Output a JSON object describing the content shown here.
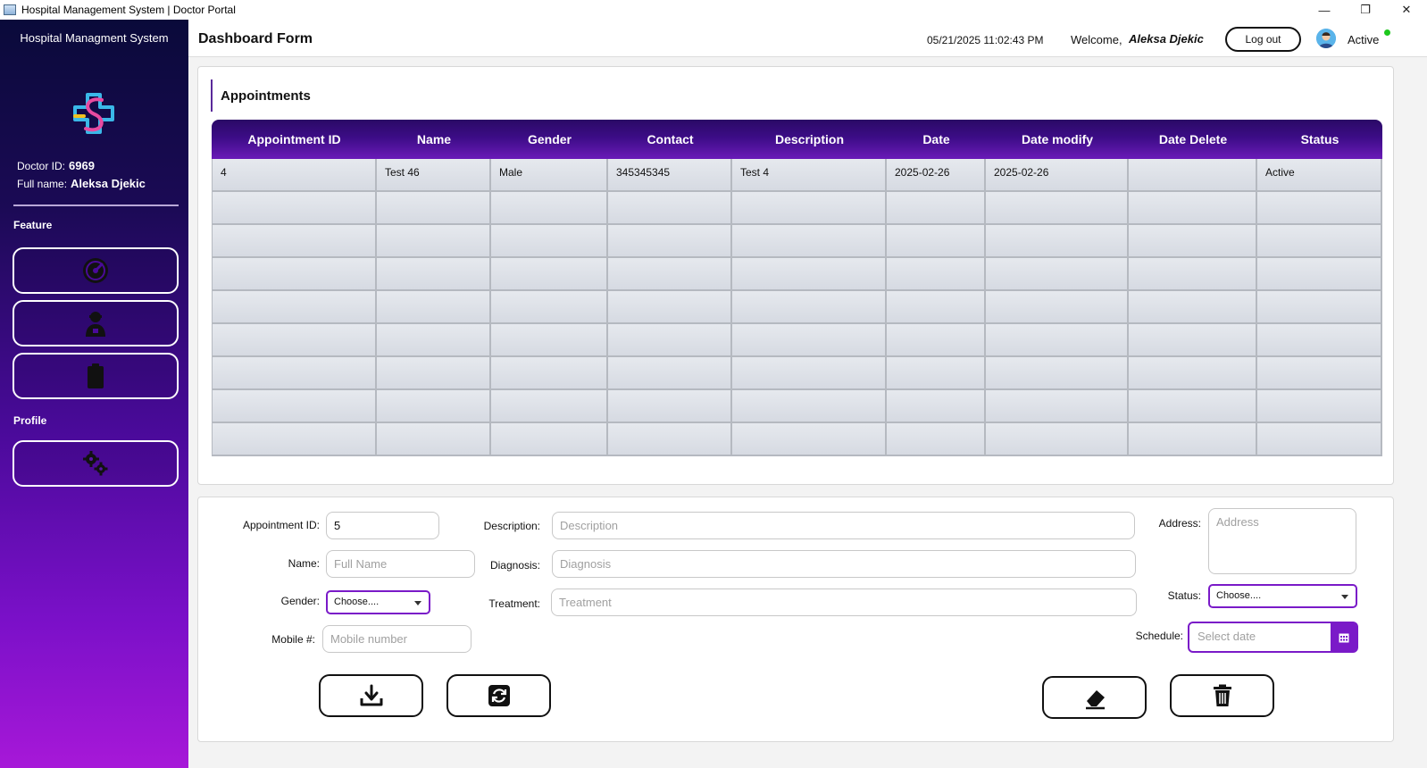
{
  "window": {
    "title": "Hospital Management System | Doctor Portal",
    "minimize": "—",
    "maximize": "❐",
    "close": "✕"
  },
  "sidebar": {
    "app_name": "Hospital Managment System",
    "doctor_id_label": "Doctor ID:",
    "doctor_id": "6969",
    "full_name_label": "Full name:",
    "full_name": "Aleksa Djekic",
    "feature_label": "Feature",
    "profile_label": "Profile",
    "buttons": [
      "dashboard-icon",
      "doctor-icon",
      "clipboard-icon",
      "settings-gears-icon"
    ]
  },
  "header": {
    "title": "Dashboard Form",
    "datetime": "05/21/2025 11:02:43 PM",
    "welcome": "Welcome,",
    "username": "Aleksa Djekic",
    "logout_label": "Log out",
    "status": "Active"
  },
  "appointments": {
    "title": "Appointments",
    "columns": [
      "Appointment ID",
      "Name",
      "Gender",
      "Contact",
      "Description",
      "Date",
      "Date modify",
      "Date Delete",
      "Status"
    ],
    "rows": [
      [
        "4",
        "Test 46",
        "Male",
        "345345345",
        "Test 4",
        "2025-02-26",
        "2025-02-26",
        "",
        "Active"
      ],
      [
        "",
        "",
        "",
        "",
        "",
        "",
        "",
        "",
        ""
      ],
      [
        "",
        "",
        "",
        "",
        "",
        "",
        "",
        "",
        ""
      ],
      [
        "",
        "",
        "",
        "",
        "",
        "",
        "",
        "",
        ""
      ],
      [
        "",
        "",
        "",
        "",
        "",
        "",
        "",
        "",
        ""
      ],
      [
        "",
        "",
        "",
        "",
        "",
        "",
        "",
        "",
        ""
      ],
      [
        "",
        "",
        "",
        "",
        "",
        "",
        "",
        "",
        ""
      ],
      [
        "",
        "",
        "",
        "",
        "",
        "",
        "",
        "",
        ""
      ],
      [
        "",
        "",
        "",
        "",
        "",
        "",
        "",
        "",
        ""
      ]
    ]
  },
  "form": {
    "appointment_id_label": "Appointment ID:",
    "appointment_id_value": "5",
    "name_label": "Name:",
    "name_placeholder": "Full Name",
    "gender_label": "Gender:",
    "gender_value": "Choose....",
    "mobile_label": "Mobile #:",
    "mobile_placeholder": "Mobile number",
    "description_label": "Description:",
    "description_placeholder": "Description",
    "diagnosis_label": "Diagnosis:",
    "diagnosis_placeholder": "Diagnosis",
    "treatment_label": "Treatment:",
    "treatment_placeholder": "Treatment",
    "address_label": "Address:",
    "address_placeholder": "Address",
    "status_label": "Status:",
    "status_value": "Choose....",
    "schedule_label": "Schedule:",
    "schedule_placeholder": "Select date"
  },
  "colors": {
    "accent": "#7a1ac8",
    "header_dark": "#2a0a66",
    "active_dot": "#1ec81e"
  }
}
